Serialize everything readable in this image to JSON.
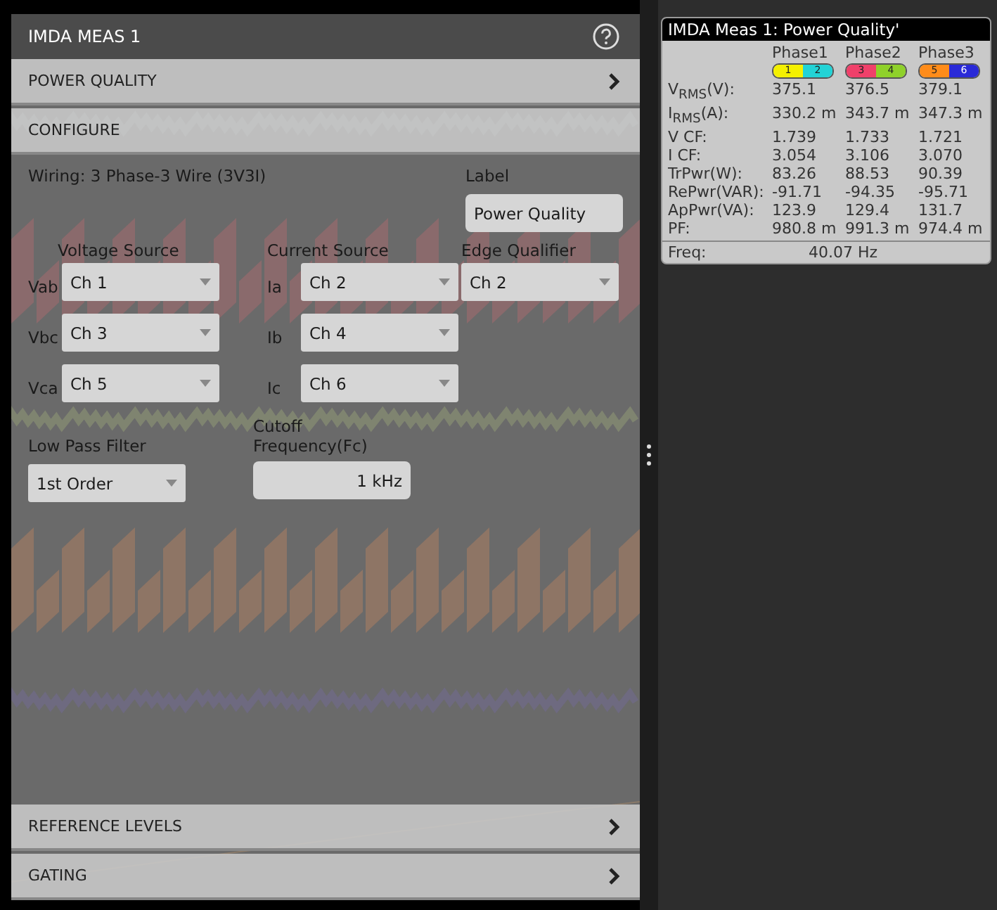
{
  "panel": {
    "title": "IMDA MEAS 1",
    "sections": [
      {
        "label": "POWER QUALITY",
        "kind": "link"
      },
      {
        "label": "CONFIGURE",
        "kind": "header"
      }
    ]
  },
  "configure": {
    "wiring": "Wiring: 3 Phase-3 Wire (3V3I)",
    "label_title": "Label",
    "label_value": "Power Quality",
    "voltage_title": "Voltage Source",
    "current_title": "Current Source",
    "edge_title": "Edge Qualifier",
    "voltage": [
      {
        "name": "Vab",
        "value": "Ch 1"
      },
      {
        "name": "Vbc",
        "value": "Ch 3"
      },
      {
        "name": "Vca",
        "value": "Ch 5"
      }
    ],
    "current": [
      {
        "name": "Ia",
        "value": "Ch 2"
      },
      {
        "name": "Ib",
        "value": "Ch 4"
      },
      {
        "name": "Ic",
        "value": "Ch 6"
      }
    ],
    "edge": "Ch 2",
    "lpf_title": "Low Pass Filter",
    "lpf_value": "1st Order",
    "cutoff_title": "Cutoff Frequency(Fc)",
    "cutoff_value": "1 kHz"
  },
  "footer_sections": [
    {
      "label": "REFERENCE LEVELS"
    },
    {
      "label": "GATING"
    }
  ],
  "results": {
    "title": "IMDA Meas 1: Power Quality'",
    "phases": [
      {
        "label": "Phase1",
        "channels": [
          {
            "number": "1",
            "color": "#f4f000"
          },
          {
            "number": "2",
            "color": "#22d3d6"
          }
        ]
      },
      {
        "label": "Phase2",
        "channels": [
          {
            "number": "3",
            "color": "#f0406a"
          },
          {
            "number": "4",
            "color": "#8fd12a"
          }
        ]
      },
      {
        "label": "Phase3",
        "channels": [
          {
            "number": "5",
            "color": "#ff8c1a"
          },
          {
            "number": "6",
            "color": "#2a2ad8"
          }
        ]
      }
    ],
    "rows": [
      {
        "label": "V$_{RMS}$(V):",
        "values": [
          "375.1",
          "376.5",
          "379.1"
        ]
      },
      {
        "label": "I$_{RMS}$(A):",
        "values": [
          "330.2 m",
          "343.7 m",
          "347.3 m"
        ]
      },
      {
        "label": "V CF:",
        "values": [
          "1.739",
          "1.733",
          "1.721"
        ]
      },
      {
        "label": "I CF:",
        "values": [
          "3.054",
          "3.106",
          "3.070"
        ]
      },
      {
        "label": "TrPwr(W):",
        "values": [
          "83.26",
          "88.53",
          "90.39"
        ]
      },
      {
        "label": "RePwr(VAR):",
        "values": [
          "-91.71",
          "-94.35",
          "-95.71"
        ]
      },
      {
        "label": "ApPwr(VA):",
        "values": [
          "123.9",
          "129.4",
          "131.7"
        ]
      },
      {
        "label": "PF:",
        "values": [
          "980.8 m",
          "991.3 m",
          "974.4 m"
        ]
      }
    ],
    "freq_label": "Freq:",
    "freq_value": "40.07 Hz"
  }
}
